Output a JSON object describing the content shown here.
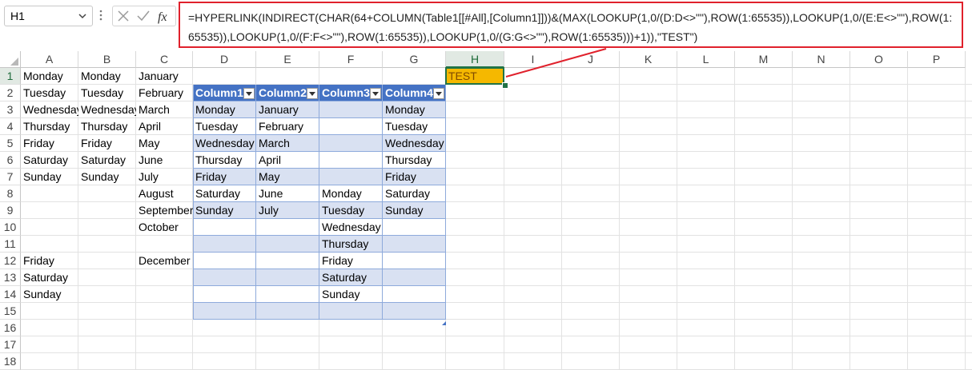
{
  "formula_bar": {
    "name_box": "H1",
    "formula": "=HYPERLINK(INDIRECT(CHAR(64+COLUMN(Table1[[#All],[Column1]]))&(MAX(LOOKUP(1,0/(D:D<>\"\"),ROW(1:65535)),LOOKUP(1,0/(E:E<>\"\"),ROW(1:65535)),LOOKUP(1,0/(F:F<>\"\"),ROW(1:65535)),LOOKUP(1,0/(G:G<>\"\"),ROW(1:65535)))+1)),\"TEST\")",
    "cancel_icon": "x-icon",
    "enter_icon": "check-icon",
    "fx_icon": "fx-icon",
    "highlight_color": "#e0212c"
  },
  "columns": [
    "A",
    "B",
    "C",
    "D",
    "E",
    "F",
    "G",
    "H",
    "I",
    "J",
    "K",
    "L",
    "M",
    "N",
    "O",
    "P"
  ],
  "rows": [
    "1",
    "2",
    "3",
    "4",
    "5",
    "6",
    "7",
    "8",
    "9",
    "10",
    "11",
    "12",
    "13",
    "14",
    "15",
    "16",
    "17",
    "18"
  ],
  "selected_column": "H",
  "selected_row": "1",
  "active_cell": {
    "ref": "H1",
    "value": "TEST",
    "fill": "#f5b800"
  },
  "table": {
    "header_color": "#4472c4",
    "band_color": "#d9e1f2",
    "headers": [
      "Column1",
      "Column2",
      "Column3",
      "Column4"
    ]
  },
  "cells": {
    "A1": "Monday",
    "B1": "Monday",
    "C1": "January",
    "A2": "Tuesday",
    "B2": "Tuesday",
    "C2": "February",
    "A3": "Wednesday",
    "B3": "Wednesday",
    "C3": "March",
    "D3": "Monday",
    "E3": "January",
    "G3": "Monday",
    "A4": "Thursday",
    "B4": "Thursday",
    "C4": "April",
    "D4": "Tuesday",
    "E4": "February",
    "G4": "Tuesday",
    "A5": "Friday",
    "B5": "Friday",
    "C5": "May",
    "D5": "Wednesday",
    "E5": "March",
    "G5": "Wednesday",
    "A6": "Saturday",
    "B6": "Saturday",
    "C6": "June",
    "D6": "Thursday",
    "E6": "April",
    "G6": "Thursday",
    "A7": "Sunday",
    "B7": "Sunday",
    "C7": "July",
    "D7": "Friday",
    "E7": "May",
    "G7": "Friday",
    "C8": "August",
    "D8": "Saturday",
    "E8": "June",
    "F8": "Monday",
    "G8": "Saturday",
    "C9": "September",
    "D9": "Sunday",
    "E9": "July",
    "F9": "Tuesday",
    "G9": "Sunday",
    "C10": "October",
    "F10": "Wednesday",
    "F11": "Thursday",
    "A12": "Friday",
    "C12": "December",
    "F12": "Friday",
    "A13": "Saturday",
    "F13": "Saturday",
    "A14": "Sunday",
    "F14": "Sunday"
  }
}
